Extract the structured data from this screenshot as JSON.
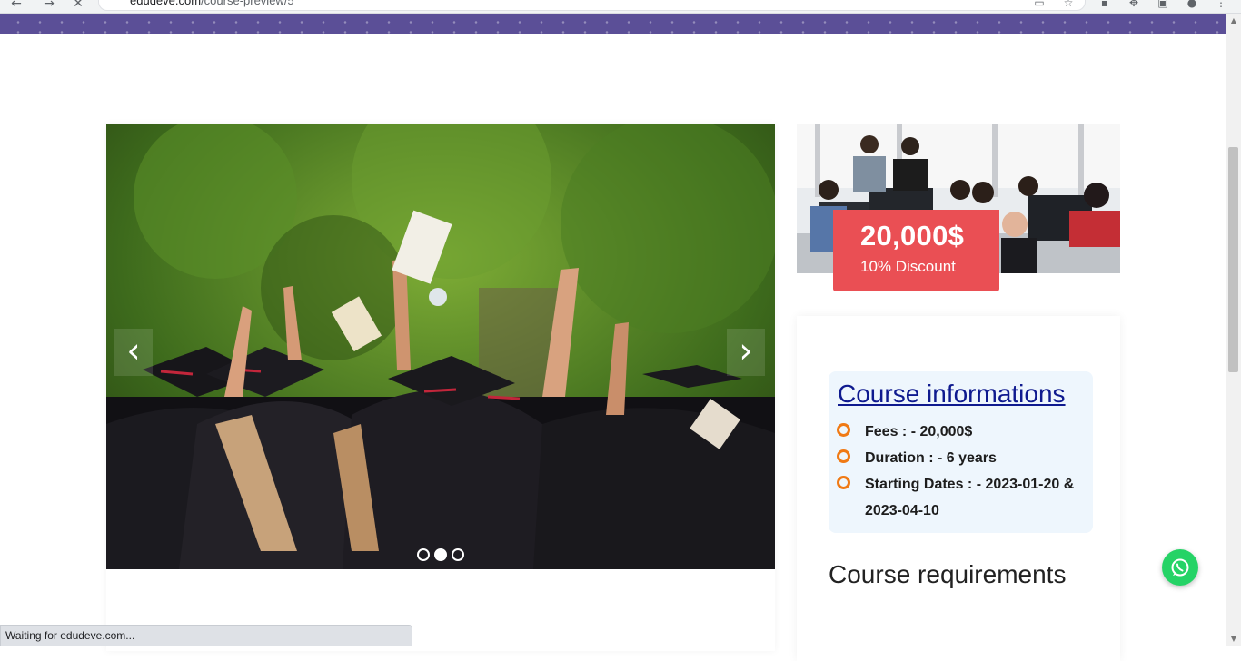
{
  "browser": {
    "url_domain": "edudeve.com",
    "url_path": "/course-preview/5",
    "status_text": "Waiting for edudeve.com..."
  },
  "slider": {
    "prev_icon": "chevron-left-icon",
    "next_icon": "chevron-right-icon",
    "dots_count": 3,
    "active_dot": 1
  },
  "price": {
    "amount": "20,000$",
    "discount": "10% Discount"
  },
  "course_info": {
    "title": "Course informations",
    "items": [
      "Fees : - 20,000$",
      "Duration : - 6 years",
      "Starting Dates : - 2023-01-20 & 2023-04-10"
    ]
  },
  "requirements": {
    "title": "Course requirements"
  },
  "floating": {
    "whatsapp_icon": "whatsapp-icon"
  },
  "colors": {
    "header": "#5b4f97",
    "price_badge": "#ea4f54",
    "info_title": "#0f1a8f",
    "bullet": "#f07a15",
    "info_bg": "#eef6fd",
    "whatsapp": "#25d366"
  }
}
